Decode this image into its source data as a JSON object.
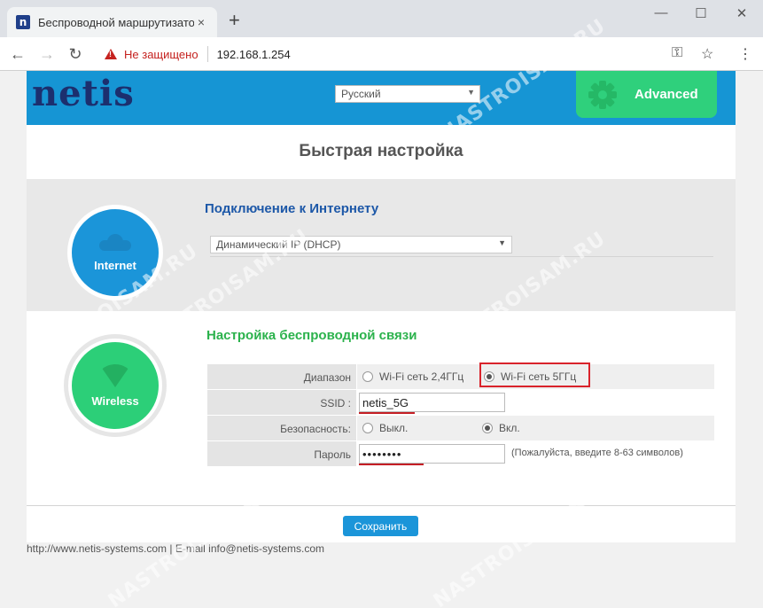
{
  "browser": {
    "tab_title": "Беспроводной маршрутизатор",
    "tab_close": "×",
    "new_tab": "+",
    "window_controls": {
      "minimize": "—",
      "maximize": "☐",
      "close": "✕"
    },
    "back": "←",
    "forward": "→",
    "reload": "↻",
    "security_label": "Не защищено",
    "url": "192.168.1.254",
    "key_icon": "⚿",
    "star_icon": "☆",
    "menu_icon": "⋮"
  },
  "header": {
    "logo": "netis",
    "language": "Русский",
    "advanced_label": "Advanced"
  },
  "page_title": "Быстрая настройка",
  "internet": {
    "badge": "Internet",
    "heading": "Подключение к Интернету",
    "connection_type": "Динамический IP (DHCP)"
  },
  "wireless": {
    "badge": "Wireless",
    "heading": "Настройка беспроводной связи",
    "band_label": "Диапазон",
    "band_24": "Wi-Fi сеть 2,4ГГц",
    "band_5": "Wi-Fi сеть 5ГГц",
    "ssid_label": "SSID :",
    "ssid_value": "netis_5G",
    "security_label": "Безопасность:",
    "security_off": "Выкл.",
    "security_on": "Вкл.",
    "password_label": "Пароль",
    "password_value": "••••••••",
    "password_hint": "(Пожалуйста, введите 8-63 символов)"
  },
  "save_label": "Сохранить",
  "footer": "http://www.netis-systems.com | E-mail info@netis-systems.com",
  "watermark": "NASTROISAM.RU",
  "colors": {
    "header_blue": "#1695d4",
    "advanced_green": "#2fd07c",
    "internet_blue": "#1b95d9",
    "wireless_green": "#2ccf78",
    "highlight_red": "#d9232b"
  }
}
